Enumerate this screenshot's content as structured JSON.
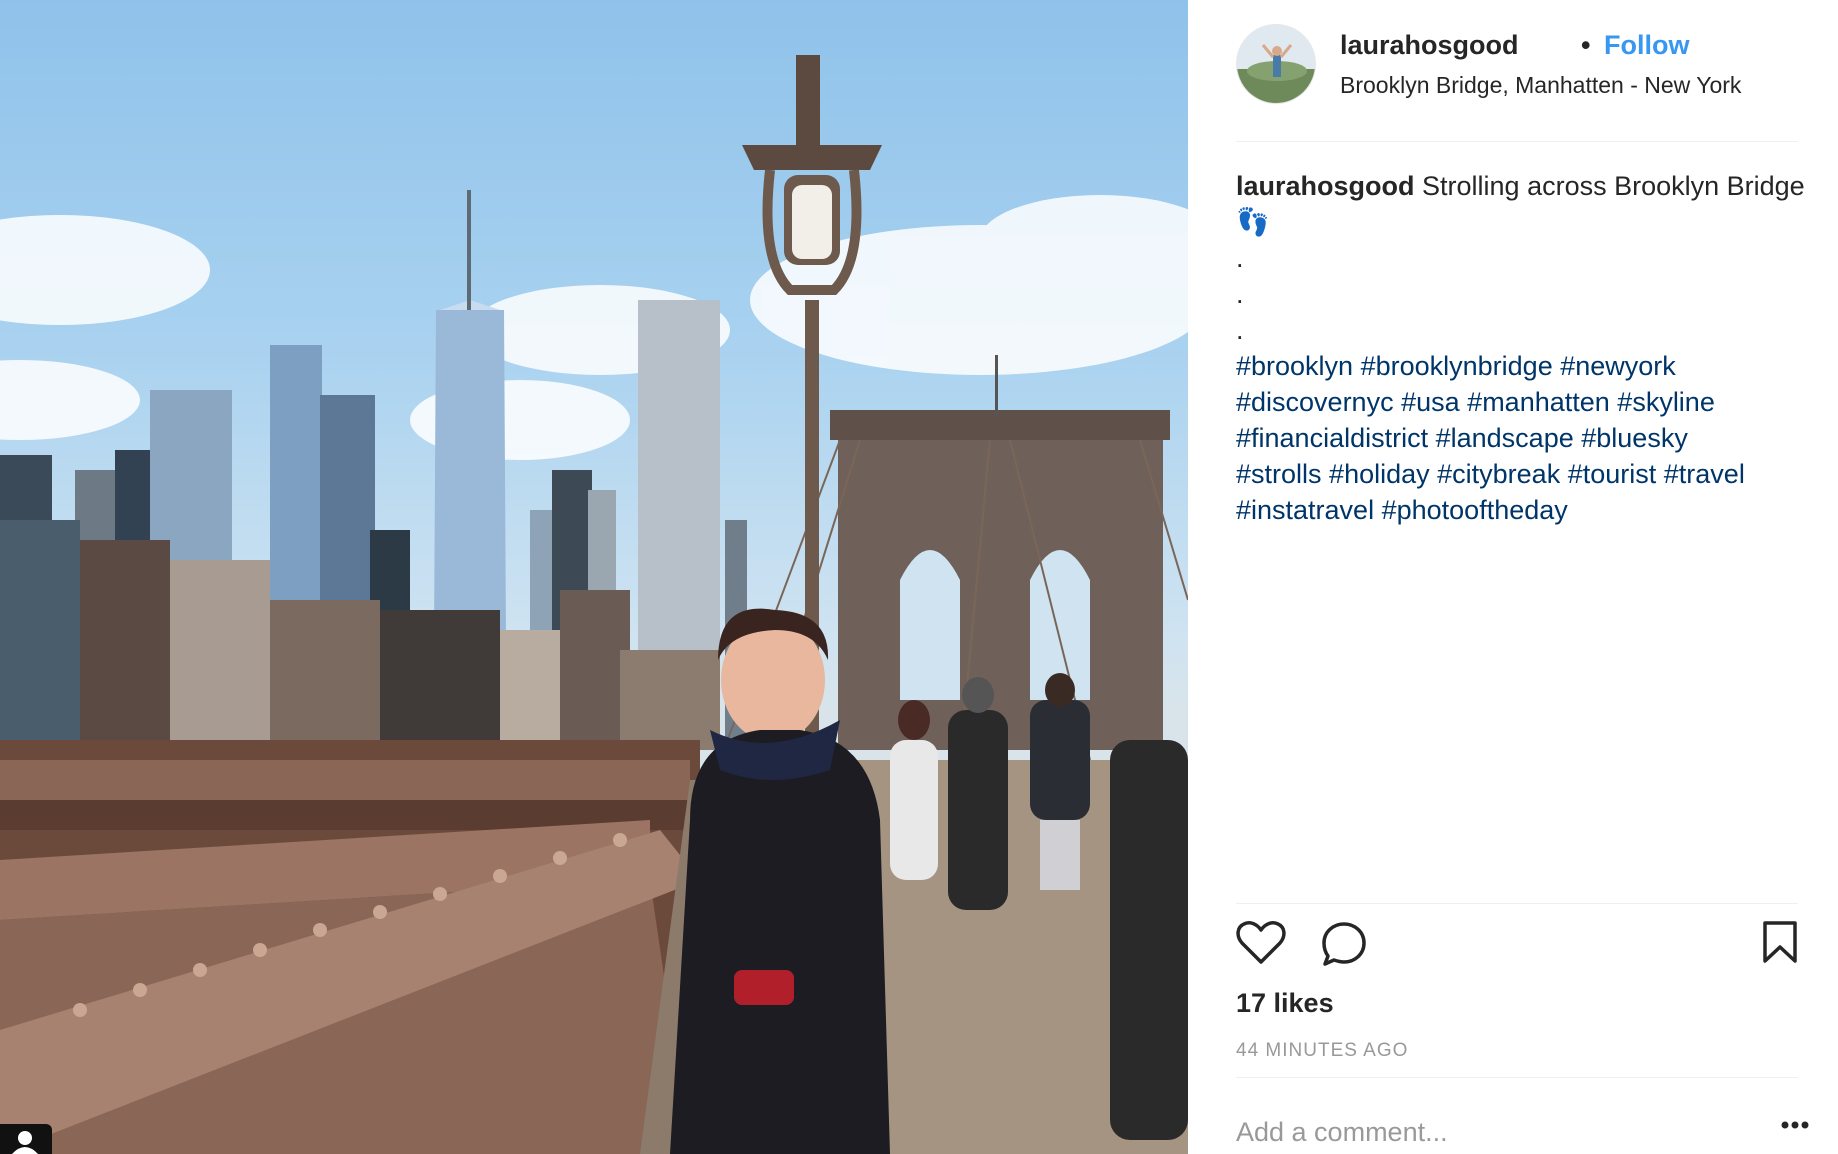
{
  "post": {
    "username": "laurahosgood",
    "separator": "•",
    "follow_label": "Follow",
    "location": "Brooklyn Bridge, Manhatten - New York"
  },
  "caption": {
    "username": "laurahosgood",
    "text": "Strolling across Brooklyn Bridge",
    "emoji": "👣",
    "dots": [
      ".",
      ".",
      "."
    ],
    "hashtags": [
      "#brooklyn",
      "#brooklynbridge",
      "#newyork",
      "#discovernyc",
      "#usa",
      "#manhatten",
      "#skyline",
      "#financialdistrict",
      "#landscape",
      "#bluesky",
      "#strolls",
      "#holiday",
      "#citybreak",
      "#tourist",
      "#travel",
      "#instatravel",
      "#photooftheday"
    ]
  },
  "engagement": {
    "likes": "17 likes",
    "time_ago": "44 MINUTES AGO"
  },
  "comment": {
    "placeholder": "Add a comment..."
  },
  "icons": {
    "like": "heart-icon",
    "comment": "comment-bubble-icon",
    "save": "bookmark-icon",
    "more": "more-options-icon"
  },
  "colors": {
    "follow": "#3897f0",
    "hashtag": "#003569",
    "muted": "#999999",
    "text": "#262626"
  }
}
